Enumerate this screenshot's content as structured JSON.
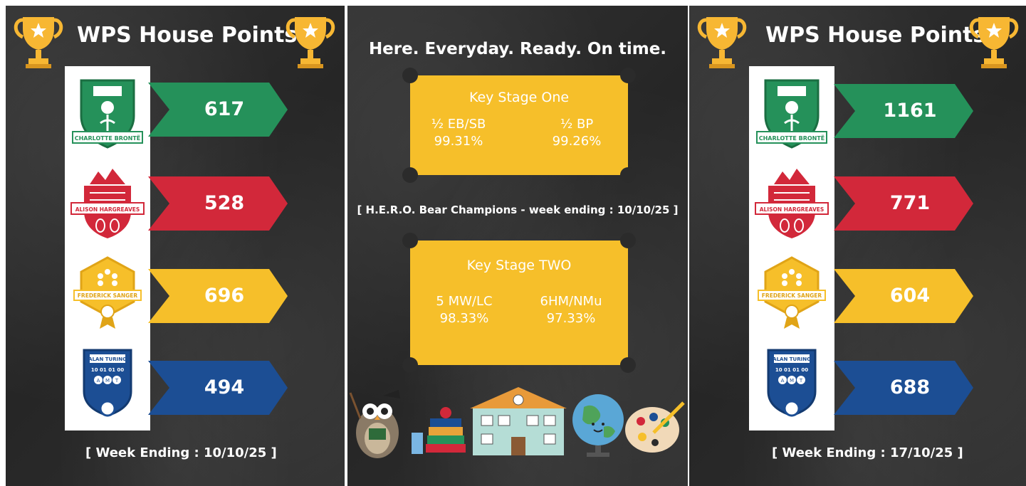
{
  "left_board": {
    "title": "WPS House Points",
    "week_ending": "[ Week Ending : 10/10/25 ]",
    "houses": [
      {
        "name": "CHARLOTTE BRONTË",
        "points": "617",
        "color": "#25915a"
      },
      {
        "name": "ALISON HARGREAVES",
        "points": "528",
        "color": "#d2283a"
      },
      {
        "name": "FREDERICK SANGER",
        "points": "696",
        "color": "#f6bf2a"
      },
      {
        "name": "ALAN TURING",
        "points": "494",
        "color": "#1c4e94"
      }
    ]
  },
  "middle_board": {
    "headline": "Here. Everyday. Ready. On time.",
    "key_stage_one": {
      "title": "Key Stage One",
      "classes": [
        {
          "class": "½ EB/SB",
          "attendance": "99.31%"
        },
        {
          "class": "½ BP",
          "attendance": "99.26%"
        }
      ]
    },
    "hero_banner": "[ H.E.R.O. Bear Champions - week ending : 10/10/25 ]",
    "key_stage_two": {
      "title": "Key Stage TWO",
      "classes": [
        {
          "class": "5 MW/LC",
          "attendance": "98.33%"
        },
        {
          "class": "6HM/NMu",
          "attendance": "97.33%"
        }
      ]
    }
  },
  "right_board": {
    "title": "WPS House Points",
    "week_ending": "[ Week Ending : 17/10/25 ]",
    "houses": [
      {
        "name": "CHARLOTTE BRONTË",
        "points": "1161",
        "color": "#25915a"
      },
      {
        "name": "ALISON HARGREAVES",
        "points": "771",
        "color": "#d2283a"
      },
      {
        "name": "FREDERICK SANGER",
        "points": "604",
        "color": "#f6bf2a"
      },
      {
        "name": "ALAN TURING",
        "points": "688",
        "color": "#1c4e94"
      }
    ]
  },
  "crest_text": {
    "turing_code": "10 01 01 00",
    "turing_letters": [
      "A",
      "M",
      "T"
    ]
  },
  "icons": [
    "trophy-icon",
    "owl-teacher-icon",
    "books-icon",
    "school-building-icon",
    "globe-icon",
    "paint-palette-icon"
  ]
}
